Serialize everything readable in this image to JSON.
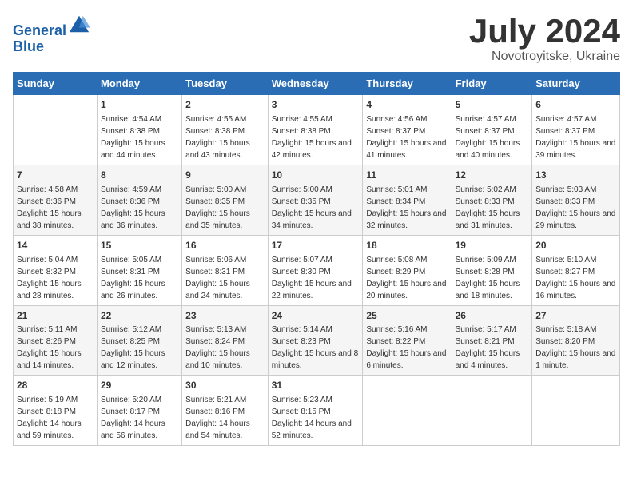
{
  "logo": {
    "line1": "General",
    "line2": "Blue"
  },
  "title": "July 2024",
  "subtitle": "Novotroyitske, Ukraine",
  "days": [
    "Sunday",
    "Monday",
    "Tuesday",
    "Wednesday",
    "Thursday",
    "Friday",
    "Saturday"
  ],
  "weeks": [
    [
      {
        "date": "",
        "sunrise": "",
        "sunset": "",
        "daylight": ""
      },
      {
        "date": "1",
        "sunrise": "Sunrise: 4:54 AM",
        "sunset": "Sunset: 8:38 PM",
        "daylight": "Daylight: 15 hours and 44 minutes."
      },
      {
        "date": "2",
        "sunrise": "Sunrise: 4:55 AM",
        "sunset": "Sunset: 8:38 PM",
        "daylight": "Daylight: 15 hours and 43 minutes."
      },
      {
        "date": "3",
        "sunrise": "Sunrise: 4:55 AM",
        "sunset": "Sunset: 8:38 PM",
        "daylight": "Daylight: 15 hours and 42 minutes."
      },
      {
        "date": "4",
        "sunrise": "Sunrise: 4:56 AM",
        "sunset": "Sunset: 8:37 PM",
        "daylight": "Daylight: 15 hours and 41 minutes."
      },
      {
        "date": "5",
        "sunrise": "Sunrise: 4:57 AM",
        "sunset": "Sunset: 8:37 PM",
        "daylight": "Daylight: 15 hours and 40 minutes."
      },
      {
        "date": "6",
        "sunrise": "Sunrise: 4:57 AM",
        "sunset": "Sunset: 8:37 PM",
        "daylight": "Daylight: 15 hours and 39 minutes."
      }
    ],
    [
      {
        "date": "7",
        "sunrise": "Sunrise: 4:58 AM",
        "sunset": "Sunset: 8:36 PM",
        "daylight": "Daylight: 15 hours and 38 minutes."
      },
      {
        "date": "8",
        "sunrise": "Sunrise: 4:59 AM",
        "sunset": "Sunset: 8:36 PM",
        "daylight": "Daylight: 15 hours and 36 minutes."
      },
      {
        "date": "9",
        "sunrise": "Sunrise: 5:00 AM",
        "sunset": "Sunset: 8:35 PM",
        "daylight": "Daylight: 15 hours and 35 minutes."
      },
      {
        "date": "10",
        "sunrise": "Sunrise: 5:00 AM",
        "sunset": "Sunset: 8:35 PM",
        "daylight": "Daylight: 15 hours and 34 minutes."
      },
      {
        "date": "11",
        "sunrise": "Sunrise: 5:01 AM",
        "sunset": "Sunset: 8:34 PM",
        "daylight": "Daylight: 15 hours and 32 minutes."
      },
      {
        "date": "12",
        "sunrise": "Sunrise: 5:02 AM",
        "sunset": "Sunset: 8:33 PM",
        "daylight": "Daylight: 15 hours and 31 minutes."
      },
      {
        "date": "13",
        "sunrise": "Sunrise: 5:03 AM",
        "sunset": "Sunset: 8:33 PM",
        "daylight": "Daylight: 15 hours and 29 minutes."
      }
    ],
    [
      {
        "date": "14",
        "sunrise": "Sunrise: 5:04 AM",
        "sunset": "Sunset: 8:32 PM",
        "daylight": "Daylight: 15 hours and 28 minutes."
      },
      {
        "date": "15",
        "sunrise": "Sunrise: 5:05 AM",
        "sunset": "Sunset: 8:31 PM",
        "daylight": "Daylight: 15 hours and 26 minutes."
      },
      {
        "date": "16",
        "sunrise": "Sunrise: 5:06 AM",
        "sunset": "Sunset: 8:31 PM",
        "daylight": "Daylight: 15 hours and 24 minutes."
      },
      {
        "date": "17",
        "sunrise": "Sunrise: 5:07 AM",
        "sunset": "Sunset: 8:30 PM",
        "daylight": "Daylight: 15 hours and 22 minutes."
      },
      {
        "date": "18",
        "sunrise": "Sunrise: 5:08 AM",
        "sunset": "Sunset: 8:29 PM",
        "daylight": "Daylight: 15 hours and 20 minutes."
      },
      {
        "date": "19",
        "sunrise": "Sunrise: 5:09 AM",
        "sunset": "Sunset: 8:28 PM",
        "daylight": "Daylight: 15 hours and 18 minutes."
      },
      {
        "date": "20",
        "sunrise": "Sunrise: 5:10 AM",
        "sunset": "Sunset: 8:27 PM",
        "daylight": "Daylight: 15 hours and 16 minutes."
      }
    ],
    [
      {
        "date": "21",
        "sunrise": "Sunrise: 5:11 AM",
        "sunset": "Sunset: 8:26 PM",
        "daylight": "Daylight: 15 hours and 14 minutes."
      },
      {
        "date": "22",
        "sunrise": "Sunrise: 5:12 AM",
        "sunset": "Sunset: 8:25 PM",
        "daylight": "Daylight: 15 hours and 12 minutes."
      },
      {
        "date": "23",
        "sunrise": "Sunrise: 5:13 AM",
        "sunset": "Sunset: 8:24 PM",
        "daylight": "Daylight: 15 hours and 10 minutes."
      },
      {
        "date": "24",
        "sunrise": "Sunrise: 5:14 AM",
        "sunset": "Sunset: 8:23 PM",
        "daylight": "Daylight: 15 hours and 8 minutes."
      },
      {
        "date": "25",
        "sunrise": "Sunrise: 5:16 AM",
        "sunset": "Sunset: 8:22 PM",
        "daylight": "Daylight: 15 hours and 6 minutes."
      },
      {
        "date": "26",
        "sunrise": "Sunrise: 5:17 AM",
        "sunset": "Sunset: 8:21 PM",
        "daylight": "Daylight: 15 hours and 4 minutes."
      },
      {
        "date": "27",
        "sunrise": "Sunrise: 5:18 AM",
        "sunset": "Sunset: 8:20 PM",
        "daylight": "Daylight: 15 hours and 1 minute."
      }
    ],
    [
      {
        "date": "28",
        "sunrise": "Sunrise: 5:19 AM",
        "sunset": "Sunset: 8:18 PM",
        "daylight": "Daylight: 14 hours and 59 minutes."
      },
      {
        "date": "29",
        "sunrise": "Sunrise: 5:20 AM",
        "sunset": "Sunset: 8:17 PM",
        "daylight": "Daylight: 14 hours and 56 minutes."
      },
      {
        "date": "30",
        "sunrise": "Sunrise: 5:21 AM",
        "sunset": "Sunset: 8:16 PM",
        "daylight": "Daylight: 14 hours and 54 minutes."
      },
      {
        "date": "31",
        "sunrise": "Sunrise: 5:23 AM",
        "sunset": "Sunset: 8:15 PM",
        "daylight": "Daylight: 14 hours and 52 minutes."
      },
      {
        "date": "",
        "sunrise": "",
        "sunset": "",
        "daylight": ""
      },
      {
        "date": "",
        "sunrise": "",
        "sunset": "",
        "daylight": ""
      },
      {
        "date": "",
        "sunrise": "",
        "sunset": "",
        "daylight": ""
      }
    ]
  ]
}
